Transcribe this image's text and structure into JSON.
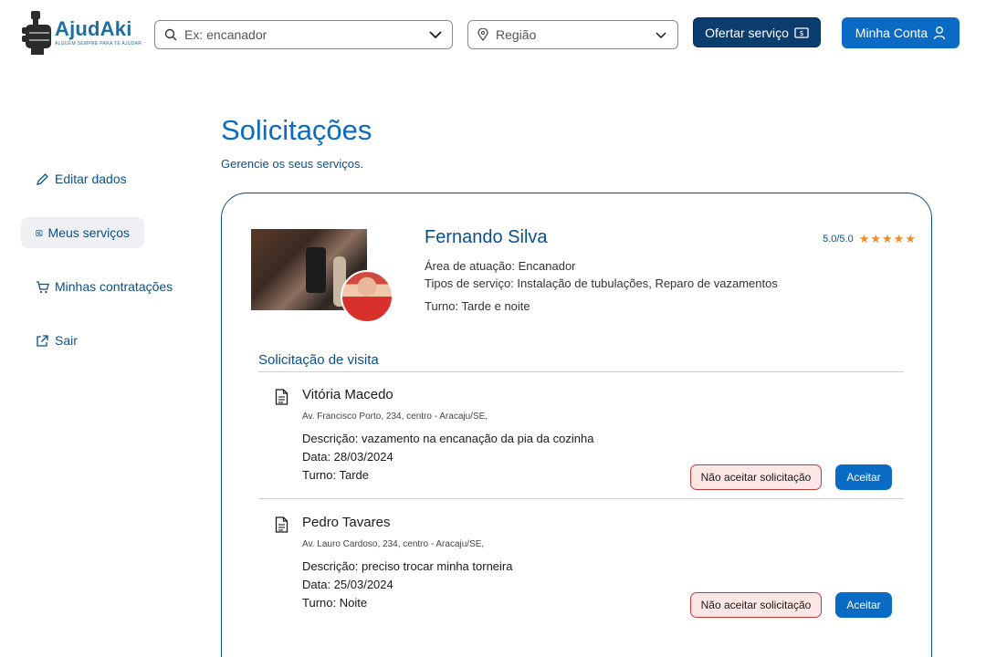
{
  "header": {
    "logo_title": "AjudAki",
    "logo_tagline": "ALGUÉM SEMPRE PARA TE AJUDAR",
    "search_placeholder": "Ex: encanador",
    "region_placeholder": "Região",
    "offer_label": "Ofertar serviço",
    "account_label": "Minha Conta"
  },
  "sidebar": {
    "items": [
      {
        "label": "Editar dados",
        "icon": "pencil-icon"
      },
      {
        "label": "Meus serviços",
        "icon": "services-icon",
        "active": true
      },
      {
        "label": "Minhas contratações",
        "icon": "cart-icon"
      },
      {
        "label": "Sair",
        "icon": "external-link-icon"
      }
    ]
  },
  "main": {
    "title": "Solicitações",
    "subtitle": "Gerencie os seus serviços."
  },
  "provider": {
    "name": "Fernando Silva",
    "rating": "5.0/5.0",
    "stars": "★★★★★",
    "area": "Área de atuação: Encanador",
    "services": "Tipos de serviço: Instalação de tubulações, Reparo de vazamentos",
    "shift": "Turno: Tarde e noite"
  },
  "requests_section": {
    "title": "Solicitação de visita",
    "decline_label": "Não aceitar solicitação",
    "accept_label": "Aceitar"
  },
  "requests": [
    {
      "name": "Vitória Macedo",
      "address": "Av. Francisco Porto, 234, centro - Aracaju/SE,",
      "description": "Descrição: vazamento na encanação da pia da cozinha",
      "date": "Data: 28/03/2024",
      "shift": "Turno: Tarde"
    },
    {
      "name": "Pedro Tavares",
      "address": "Av. Lauro Cardoso, 234, centro - Aracaju/SE,",
      "description": "Descrição: preciso trocar minha torneira",
      "date": "Data: 25/03/2024",
      "shift": "Turno: Noite"
    }
  ],
  "colors": {
    "primary": "#0a6bc4",
    "dark": "#0b3d6e",
    "star": "#f08a24",
    "decline_bg": "#fde6e6",
    "decline_border": "#c23a3a"
  }
}
